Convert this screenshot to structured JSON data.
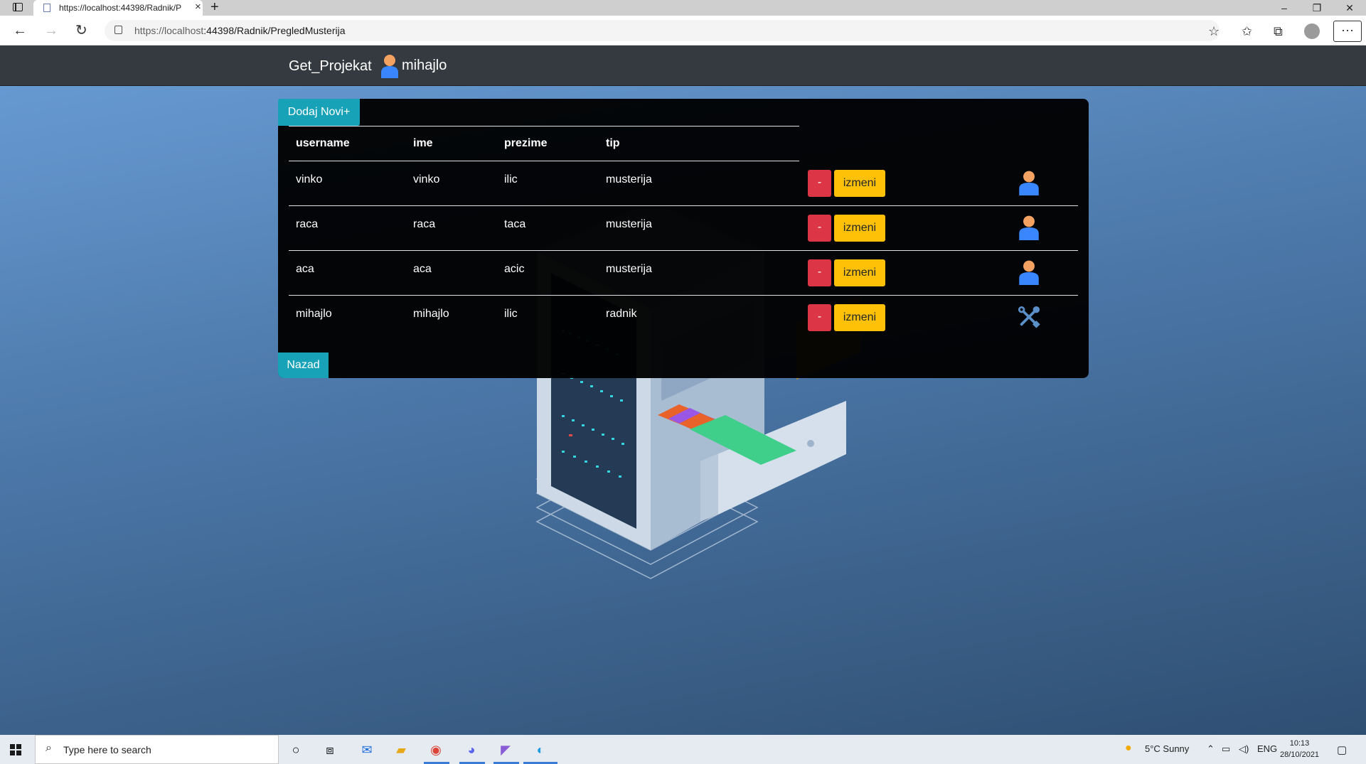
{
  "browser": {
    "tab_title": "https://localhost:44398/Radnik/P",
    "new_tab_symbol": "+",
    "url_host": "https://localhost",
    "url_path": ":44398/Radnik/PregledMusterija"
  },
  "app": {
    "brand": "Get_Projekat",
    "current_user": "mihajlo",
    "add_button": "Dodaj Novi+",
    "back_button": "Nazad",
    "columns": [
      "username",
      "ime",
      "prezime",
      "tip"
    ],
    "delete_label": "-",
    "edit_label": "izmeni",
    "rows": [
      {
        "username": "vinko",
        "ime": "vinko",
        "prezime": "ilic",
        "tip": "musterija",
        "icon": "user-icon"
      },
      {
        "username": "raca",
        "ime": "raca",
        "prezime": "taca",
        "tip": "musterija",
        "icon": "user-icon"
      },
      {
        "username": "aca",
        "ime": "aca",
        "prezime": "acic",
        "tip": "musterija",
        "icon": "user-icon"
      },
      {
        "username": "mihajlo",
        "ime": "mihajlo",
        "prezime": "ilic",
        "tip": "radnik",
        "icon": "tools-icon"
      }
    ]
  },
  "taskbar": {
    "search_placeholder": "Type here to search",
    "weather": "5°C  Sunny",
    "language": "ENG",
    "time": "10:13",
    "date": "28/10/2021"
  },
  "colors": {
    "info": "#17a2b8",
    "danger": "#dc3545",
    "warning": "#ffc107",
    "navbar": "#343a40"
  }
}
